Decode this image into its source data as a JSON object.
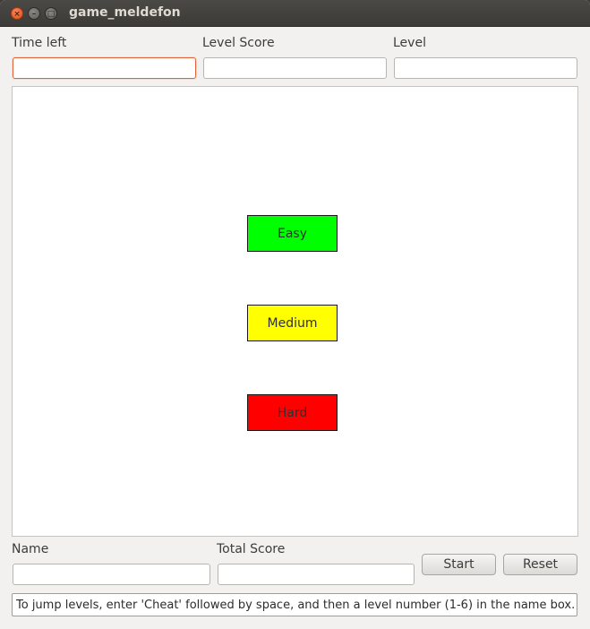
{
  "window": {
    "title": "game_meldefon",
    "controls": {
      "close": "×",
      "minimize": "–",
      "maximize": "□"
    }
  },
  "top_fields": {
    "time_left": {
      "label": "Time left",
      "value": ""
    },
    "level_score": {
      "label": "Level Score",
      "value": ""
    },
    "level": {
      "label": "Level",
      "value": ""
    }
  },
  "difficulty": {
    "easy": {
      "label": "Easy",
      "color": "#00ff00"
    },
    "medium": {
      "label": "Medium",
      "color": "#ffff00"
    },
    "hard": {
      "label": "Hard",
      "color": "#ff0000"
    }
  },
  "bottom_fields": {
    "name": {
      "label": "Name",
      "value": ""
    },
    "total_score": {
      "label": "Total Score",
      "value": ""
    }
  },
  "buttons": {
    "start": "Start",
    "reset": "Reset"
  },
  "hint": "To jump levels, enter 'Cheat' followed by space, and then a level number (1-6) in the name box."
}
